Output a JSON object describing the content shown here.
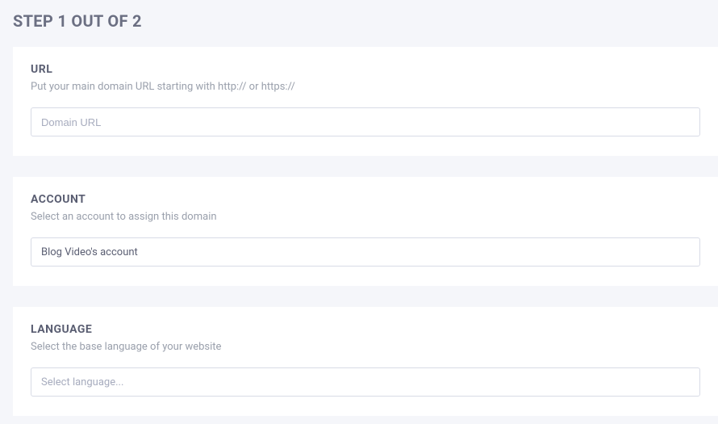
{
  "header": {
    "step_title": "STEP 1 OUT OF 2"
  },
  "sections": {
    "url": {
      "title": "URL",
      "subtitle": "Put your main domain URL starting with http:// or https://",
      "placeholder": "Domain URL",
      "value": ""
    },
    "account": {
      "title": "ACCOUNT",
      "subtitle": "Select an account to assign this domain",
      "selected": "Blog Video's account"
    },
    "language": {
      "title": "LANGUAGE",
      "subtitle": "Select the base language of your website",
      "placeholder": "Select language..."
    }
  }
}
